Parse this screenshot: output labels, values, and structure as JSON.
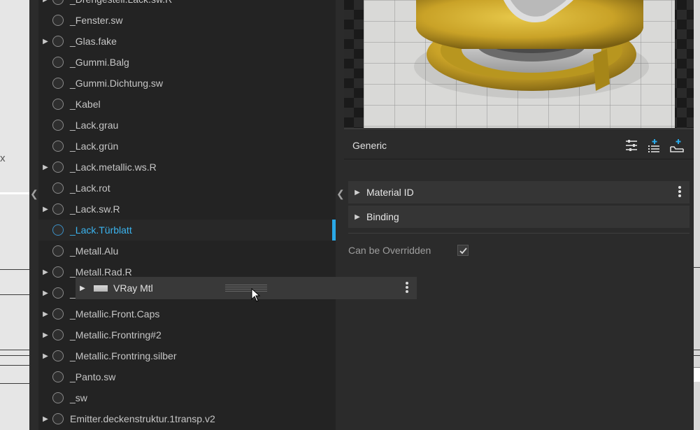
{
  "background": {
    "axis_label": "x"
  },
  "materials": [
    {
      "label": "_Drehgestell.Lack.sw.R",
      "expandable": true
    },
    {
      "label": "_Fenster.sw",
      "expandable": false
    },
    {
      "label": "_Glas.fake",
      "expandable": true
    },
    {
      "label": "_Gummi.Balg",
      "expandable": false
    },
    {
      "label": "_Gummi.Dichtung.sw",
      "expandable": false
    },
    {
      "label": "_Kabel",
      "expandable": false
    },
    {
      "label": "_Lack.grau",
      "expandable": false
    },
    {
      "label": "_Lack.grün",
      "expandable": false
    },
    {
      "label": "_Lack.metallic.ws.R",
      "expandable": true
    },
    {
      "label": "_Lack.rot",
      "expandable": false
    },
    {
      "label": "_Lack.sw.R",
      "expandable": true
    },
    {
      "label": "_Lack.Türblatt",
      "expandable": false,
      "selected": true
    },
    {
      "label": "_Metall.Alu",
      "expandable": false
    },
    {
      "label": "_Metall.Rad.R",
      "expandable": true
    },
    {
      "label": "_",
      "expandable": true
    },
    {
      "label": "_Metallic.Front.Caps",
      "expandable": true
    },
    {
      "label": "_Metallic.Frontring#2",
      "expandable": true
    },
    {
      "label": "_Metallic.Frontring.silber",
      "expandable": true
    },
    {
      "label": "_Panto.sw",
      "expandable": false
    },
    {
      "label": "_sw",
      "expandable": false
    },
    {
      "label": "Emitter.deckenstruktur.1transp.v2",
      "expandable": true
    }
  ],
  "inspector": {
    "section_title": "Generic",
    "accordions": [
      {
        "label": "Material ID"
      },
      {
        "label": "Binding"
      }
    ],
    "can_be_overridden": {
      "label": "Can be Overridden",
      "checked": true
    }
  },
  "drag_ghost": {
    "label": "VRay Mtl"
  },
  "colors": {
    "accent": "#2aa9e8",
    "selected_text": "#3bb4ef",
    "material_preview": "#c9a227"
  }
}
